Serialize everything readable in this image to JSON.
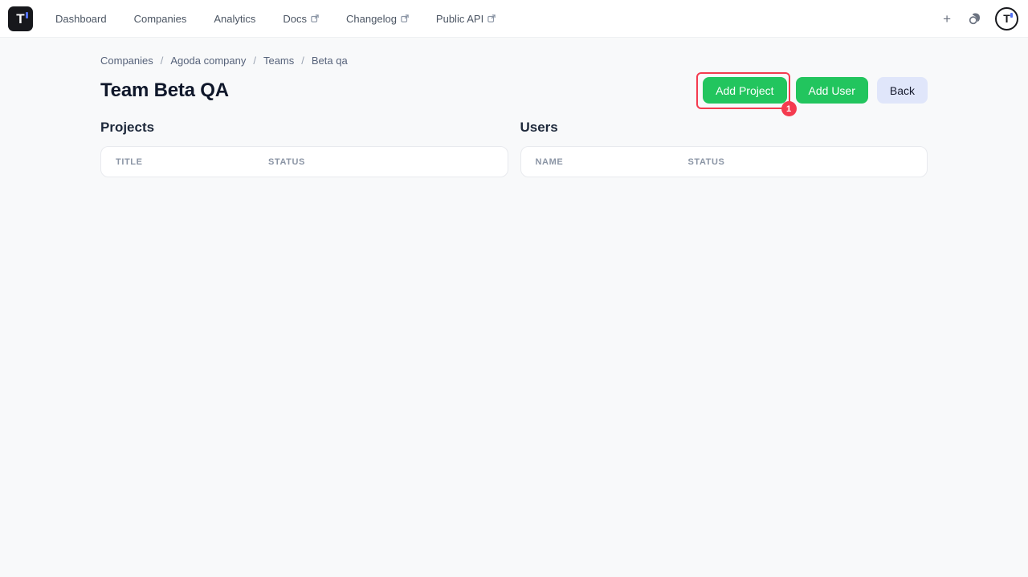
{
  "nav": {
    "logo_letter": "T",
    "avatar_letter": "T",
    "items": [
      {
        "label": "Dashboard",
        "external": false
      },
      {
        "label": "Companies",
        "external": false
      },
      {
        "label": "Analytics",
        "external": false
      },
      {
        "label": "Docs",
        "external": true
      },
      {
        "label": "Changelog",
        "external": true
      },
      {
        "label": "Public API",
        "external": true
      }
    ]
  },
  "icons": {
    "plus": "+"
  },
  "breadcrumb": {
    "separator": "/",
    "items": [
      "Companies",
      "Agoda company",
      "Teams",
      "Beta qa"
    ]
  },
  "page": {
    "title": "Team Beta QA"
  },
  "actions": {
    "add_project_label": "Add Project",
    "add_user_label": "Add User",
    "back_label": "Back"
  },
  "annotation": {
    "badge": "1"
  },
  "sections": {
    "projects": {
      "heading": "Projects",
      "columns": [
        "Title",
        "Status"
      ],
      "rows": []
    },
    "users": {
      "heading": "Users",
      "columns": [
        "Name",
        "Status"
      ],
      "rows": []
    }
  },
  "colors": {
    "accent_green": "#22c55e",
    "annotation_red": "#f43b4f",
    "back_button_bg": "#e0e6fa",
    "logo_blue": "#5472f4",
    "page_bg": "#f8f9fa"
  }
}
